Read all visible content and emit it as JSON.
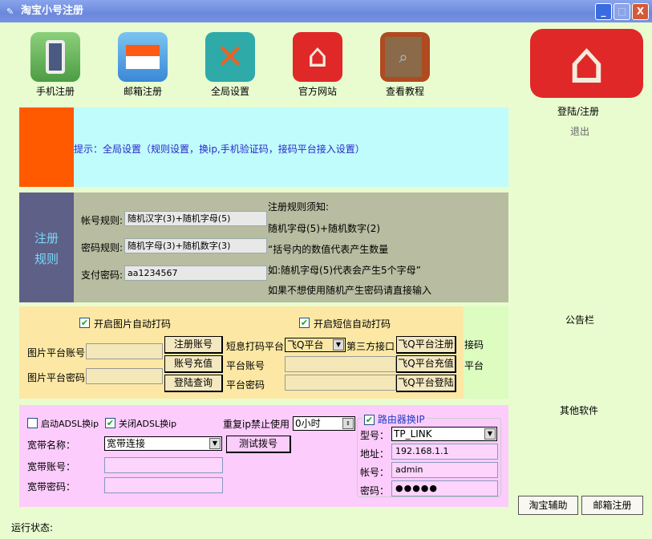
{
  "window": {
    "title": "淘宝小号注册",
    "min": "_",
    "max": "□",
    "close": "X"
  },
  "toolbar": [
    {
      "label": "手机注册",
      "color": "#6cbc5c"
    },
    {
      "label": "邮箱注册",
      "color": "#4a9ee0"
    },
    {
      "label": "全局设置",
      "color": "#2eaaa8"
    },
    {
      "label": "官方网站",
      "color": "#e02828"
    },
    {
      "label": "查看教程",
      "color": "#a0522d"
    }
  ],
  "hint": {
    "text": "提示：全局设置（规则设置，换ip,手机验证码，接码平台接入设置）"
  },
  "rules": {
    "side_title_1": "注册",
    "side_title_2": "规则",
    "account_label": "帐号规则:",
    "account_value": "随机汉字(3)+随机字母(5)",
    "password_label": "密码规则:",
    "password_value": "随机字母(3)+随机数字(3)",
    "pay_label": "支付密码:",
    "pay_value": "aa1234567",
    "notes": [
      "注册规则须知:",
      "随机字母(5)+随机数字(2)",
      "“括号内的数值代表产生数量",
      "如:随机字母(5)代表会产生5个字母”",
      "如果不想使用随机产生密码请直接输入"
    ]
  },
  "captcha": {
    "img_auto": "开启图片自动打码",
    "sms_auto": "开启短信自动打码",
    "img_account": "图片平台账号",
    "img_password": "图片平台密码",
    "btn_register": "注册账号",
    "btn_recharge": "账号充值",
    "btn_login": "登陆查询",
    "sms_platform_label": "短息打码平台",
    "sms_platform_value": "飞Q平台",
    "third_party": "第三方接口",
    "platform_account": "平台账号",
    "platform_password": "平台密码",
    "fq_register": "飞Q平台注册",
    "fq_recharge": "飞Q平台充值",
    "fq_login": "飞Q平台登陆",
    "side_1": "接码",
    "side_2": "平台"
  },
  "adsl": {
    "enable": "启动ADSL换ip",
    "disable": "关闭ADSL换ip",
    "repeat_label": "重复ip禁止使用",
    "repeat_value": "0小时",
    "bb_name_label": "宽带名称：",
    "bb_name_value": "宽带连接",
    "test_dial": "测试拨号",
    "bb_account_label": "宽带账号：",
    "bb_password_label": "宽带密码：",
    "router": {
      "title": "路由器换IP",
      "model_label": "型号：",
      "model_value": "TP_LINK",
      "addr_label": "地址：",
      "addr_value": "192.168.1.1",
      "acct_label": "帐号：",
      "acct_value": "admin",
      "pwd_label": "密码：",
      "pwd_value": "●●●●●"
    }
  },
  "right": {
    "login": "登陆/注册",
    "logout": "退出",
    "notice": "公告栏",
    "other": "其他软件",
    "taobao_helper": "淘宝辅助",
    "mail_register": "邮箱注册"
  },
  "status": {
    "label": "运行状态:"
  }
}
